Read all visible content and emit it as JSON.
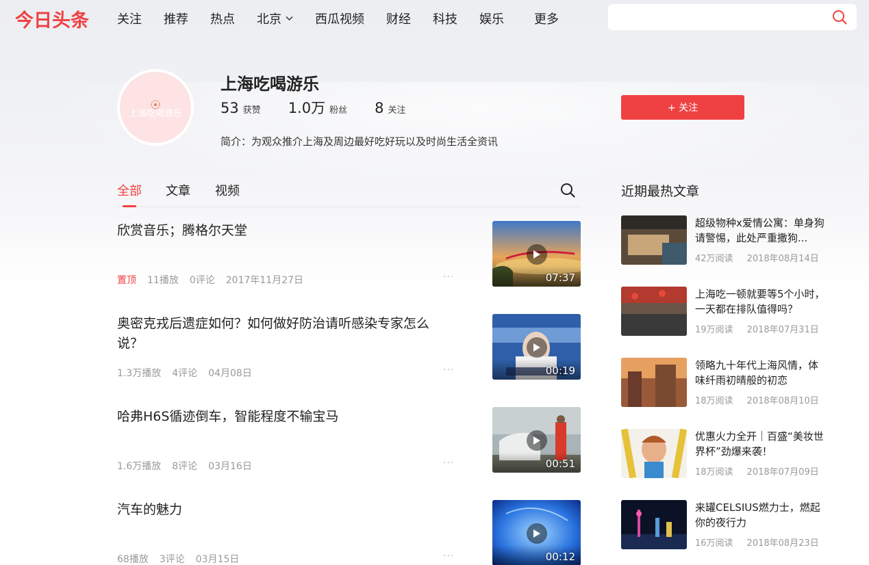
{
  "header": {
    "logo": "今日头条",
    "nav": [
      {
        "label": "关注"
      },
      {
        "label": "推荐"
      },
      {
        "label": "热点"
      },
      {
        "label": "北京",
        "has_dropdown": true
      },
      {
        "label": "西瓜视频"
      },
      {
        "label": "财经"
      },
      {
        "label": "科技"
      },
      {
        "label": "娱乐"
      },
      {
        "label": "更多"
      }
    ],
    "search": {
      "value": "",
      "placeholder": ""
    }
  },
  "profile": {
    "avatar_text": "上海吃喝游乐",
    "name": "上海吃喝游乐",
    "stats": [
      {
        "value": "53",
        "label": "获赞"
      },
      {
        "value": "1.0万",
        "label": "粉丝"
      },
      {
        "value": "8",
        "label": "关注"
      }
    ],
    "intro": "简介：为观众推介上海及周边最好吃好玩以及时尚生活全资讯",
    "follow_label": "+ 关注"
  },
  "tabs": [
    {
      "label": "全部",
      "active": true
    },
    {
      "label": "文章",
      "active": false
    },
    {
      "label": "视频",
      "active": false
    }
  ],
  "feed": [
    {
      "title": "欣赏音乐；腾格尔天堂",
      "pinned_label": "置顶",
      "plays": "11播放",
      "comments": "0评论",
      "date": "2017年11月27日",
      "duration": "07:37"
    },
    {
      "title": "奥密克戎后遗症如何？如何做好防治请听感染专家怎么说？",
      "pinned_label": "",
      "plays": "1.3万播放",
      "comments": "4评论",
      "date": "04月08日",
      "duration": "00:19"
    },
    {
      "title": "哈弗H6S循迹倒车，智能程度不输宝马",
      "pinned_label": "",
      "plays": "1.6万播放",
      "comments": "8评论",
      "date": "03月16日",
      "duration": "00:51"
    },
    {
      "title": "汽车的魅力",
      "pinned_label": "",
      "plays": "68播放",
      "comments": "3评论",
      "date": "03月15日",
      "duration": "00:12"
    }
  ],
  "feed_more_label": "···",
  "hot": {
    "title": "近期最热文章",
    "items": [
      {
        "title": "超级物种x爱情公寓：单身狗请警惕，此处严重撒狗...",
        "reads": "42万阅读",
        "date": "2018年08月14日"
      },
      {
        "title": "上海吃一顿就要等5个小时，一天都在排队值得吗？",
        "reads": "19万阅读",
        "date": "2018年07月31日"
      },
      {
        "title": "领略九十年代上海风情，体味纤雨初晴般的初恋",
        "reads": "18万阅读",
        "date": "2018年08月10日"
      },
      {
        "title": "优惠火力全开｜百盛“美妆世界杯”劲爆来袭！",
        "reads": "18万阅读",
        "date": "2018年07月09日"
      },
      {
        "title": "来罐CELSIUS燃力士，燃起你的夜行力",
        "reads": "16万阅读",
        "date": "2018年08月23日"
      }
    ]
  },
  "colors": {
    "accent": "#f04142"
  }
}
